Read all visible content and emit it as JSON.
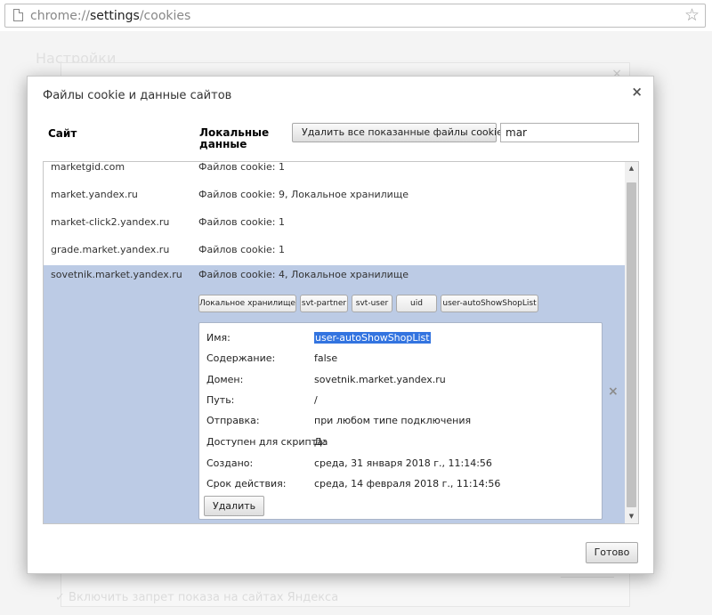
{
  "browser": {
    "url_scheme": "chrome://",
    "url_host": "settings",
    "url_path": "/cookies",
    "star_icon": "star-outline-icon"
  },
  "background": {
    "settings_title": "Настройки",
    "bottom_text": "✓  Включить запрет показа на сайтах Яндекса"
  },
  "dialog": {
    "title": "Файлы cookie и данные сайтов",
    "close_icon": "×",
    "col_site": "Сайт",
    "col_local": "Локальные данные",
    "delete_all_label": "Удалить все показанные файлы cookie",
    "search_value": "mar",
    "rows": [
      {
        "site": "marketgid.com",
        "info": "Файлов cookie: 1"
      },
      {
        "site": "market.yandex.ru",
        "info": "Файлов cookie: 9, Локальное хранилище"
      },
      {
        "site": "market-click2.yandex.ru",
        "info": "Файлов cookie: 1"
      },
      {
        "site": "grade.market.yandex.ru",
        "info": "Файлов cookie: 1"
      }
    ],
    "selected": {
      "site": "sovetnik.market.yandex.ru",
      "info": "Файлов cookie: 4, Локальное хранилище",
      "chips": [
        "Локальное хранилище",
        "svt-partner",
        "svt-user",
        "uid",
        "user-autoShowShopList"
      ],
      "details": [
        {
          "label": "Имя:",
          "value": "user-autoShowShopList"
        },
        {
          "label": "Содержание:",
          "value": "false"
        },
        {
          "label": "Домен:",
          "value": "sovetnik.market.yandex.ru"
        },
        {
          "label": "Путь:",
          "value": "/"
        },
        {
          "label": "Отправка:",
          "value": "при любом типе подключения"
        },
        {
          "label": "Доступен для скрипта:",
          "value": "Да"
        },
        {
          "label": "Создано:",
          "value": "среда, 31 января 2018 г., 11:14:56"
        },
        {
          "label": "Срок действия:",
          "value": "среда, 14 февраля 2018 г., 11:14:56"
        }
      ],
      "remove_label": "Удалить",
      "remove_icon": "×"
    },
    "scroll_up": "▲",
    "scroll_down": "▼",
    "done_label": "Готово"
  }
}
